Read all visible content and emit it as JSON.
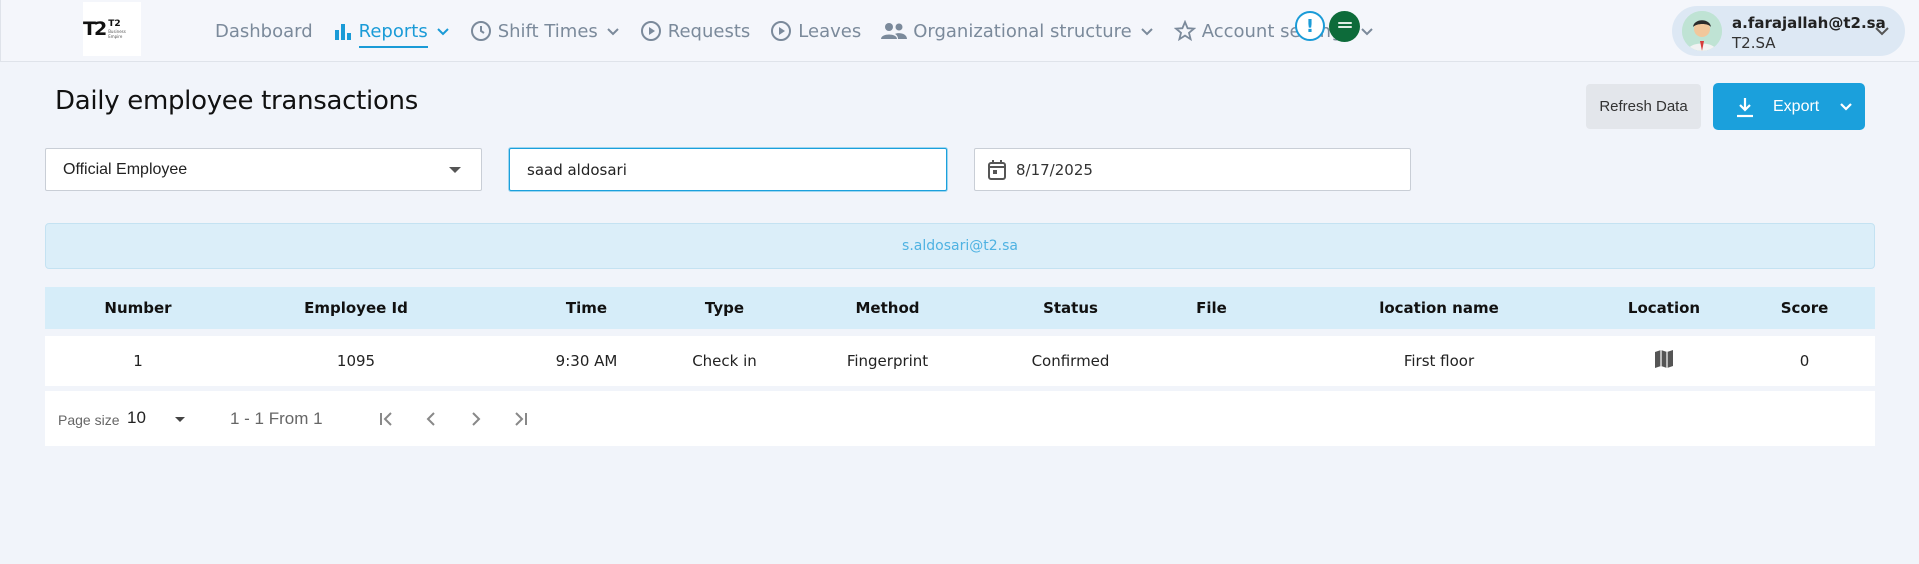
{
  "brand": {
    "mark": "T2",
    "name": "T2",
    "tagline": "Business Empire"
  },
  "nav": {
    "dashboard": "Dashboard",
    "reports": "Reports",
    "shift_times": "Shift Times",
    "requests": "Requests",
    "leaves": "Leaves",
    "org_structure": "Organizational structure",
    "account_settings": "Account settings",
    "alert": "!"
  },
  "user": {
    "email": "a.farajallah@t2.sa",
    "org": "T2.SA"
  },
  "page": {
    "title": "Daily employee transactions",
    "refresh_label": "Refresh Data",
    "export_label": "Export"
  },
  "filters": {
    "employee_type": "Official Employee",
    "search_value": "saad aldosari",
    "date": "8/17/2025"
  },
  "selected_email": "s.aldosari@t2.sa",
  "table": {
    "headers": [
      "Number",
      "Employee Id",
      "Time",
      "Type",
      "Method",
      "Status",
      "File",
      "location name",
      "Location",
      "Score"
    ],
    "rows": [
      {
        "number": "1",
        "employee_id": "1095",
        "time": "9:30 AM",
        "type": "Check in",
        "method": "Fingerprint",
        "status": "Confirmed",
        "file": "",
        "location_name": "First floor",
        "location_icon": "map-icon",
        "score": "0"
      }
    ]
  },
  "pagination": {
    "page_size_label": "Page size",
    "page_size": "10",
    "range": "1 - 1 From 1"
  },
  "colors": {
    "accent": "#1ba0dc",
    "nav_text": "#7b8a9b",
    "header_bg": "#d6edf9"
  }
}
